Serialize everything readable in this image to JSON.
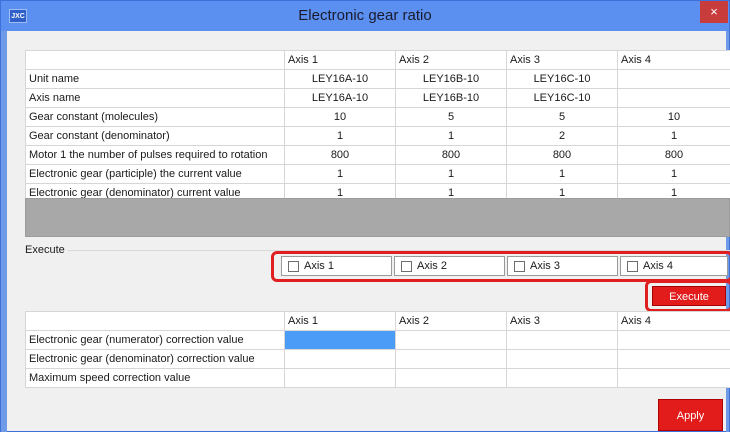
{
  "window": {
    "title": "Electronic gear ratio",
    "app_icon_text": "JXC",
    "close_glyph": "×"
  },
  "top_table": {
    "headers": [
      "",
      "Axis 1",
      "Axis 2",
      "Axis 3",
      "Axis 4"
    ],
    "rows": [
      {
        "label": "Unit name",
        "values": [
          "LEY16A-10",
          "LEY16B-10",
          "LEY16C-10",
          ""
        ]
      },
      {
        "label": "Axis name",
        "values": [
          "LEY16A-10",
          "LEY16B-10",
          "LEY16C-10",
          ""
        ]
      },
      {
        "label": "Gear constant (molecules)",
        "values": [
          "10",
          "5",
          "5",
          "10"
        ]
      },
      {
        "label": "Gear constant (denominator)",
        "values": [
          "1",
          "1",
          "2",
          "1"
        ]
      },
      {
        "label": "Motor 1 the number of pulses required to rotation",
        "values": [
          "800",
          "800",
          "800",
          "800"
        ]
      },
      {
        "label": "Electronic gear (participle) the current value",
        "values": [
          "1",
          "1",
          "1",
          "1"
        ]
      },
      {
        "label": "Electronic gear (denominator) current value",
        "values": [
          "1",
          "1",
          "1",
          "1"
        ]
      }
    ]
  },
  "execute": {
    "group_label": "Execute",
    "axes": [
      "Axis 1",
      "Axis 2",
      "Axis 3",
      "Axis 4"
    ],
    "button_label": "Execute"
  },
  "bottom_table": {
    "headers": [
      "",
      "Axis 1",
      "Axis 2",
      "Axis 3",
      "Axis 4"
    ],
    "rows": [
      {
        "label": "Electronic gear (numerator) correction value",
        "values": [
          "",
          "",
          "",
          ""
        ]
      },
      {
        "label": "Electronic gear (denominator) correction value",
        "values": [
          "",
          "",
          "",
          ""
        ]
      },
      {
        "label": "Maximum speed correction value",
        "values": [
          "",
          "",
          "",
          ""
        ]
      }
    ]
  },
  "apply_label": "Apply",
  "colors": {
    "accent_red": "#e21b1b",
    "title_bar": "#5b8ff0",
    "selected_cell": "#4a9cf6"
  }
}
